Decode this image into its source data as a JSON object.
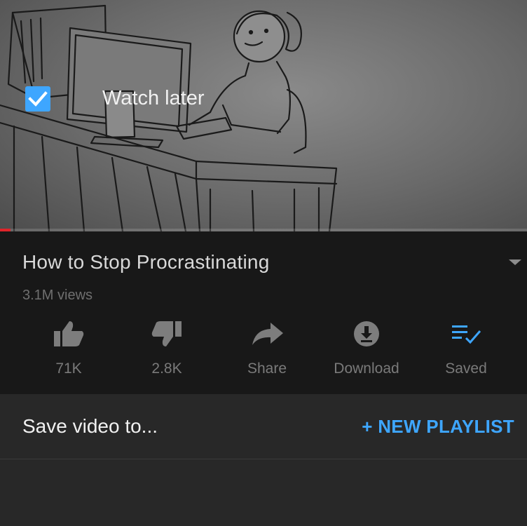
{
  "video": {
    "thumbnail": "sketch-woman-at-computer-desk",
    "progress": 0.02
  },
  "info": {
    "title": "How to Stop Procrastinating",
    "views": "3.1M views"
  },
  "actions": [
    {
      "label": "71K",
      "icon": "thumbs-up-icon"
    },
    {
      "label": "2.8K",
      "icon": "thumbs-down-icon"
    },
    {
      "label": "Share",
      "icon": "share-icon"
    },
    {
      "label": "Download",
      "icon": "download-icon"
    },
    {
      "label": "Saved",
      "icon": "saved-playlist-icon"
    }
  ],
  "save_panel": {
    "title": "Save video to...",
    "new_playlist": "+ NEW PLAYLIST",
    "items": [
      {
        "label": "Watch later",
        "checked": true
      }
    ]
  },
  "colors": {
    "accent": "#3ea6ff",
    "progress": "#e0242a",
    "panel": "#282828",
    "info_bg": "#181818"
  }
}
